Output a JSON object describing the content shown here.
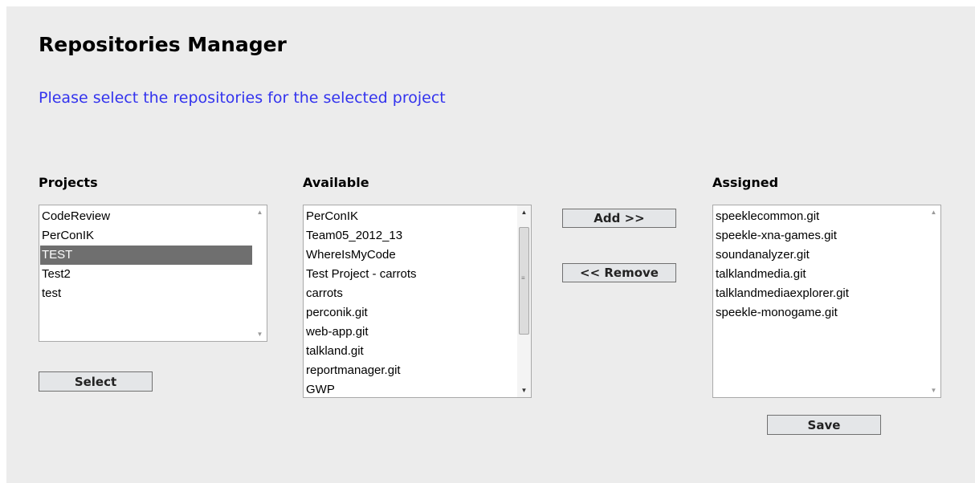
{
  "page": {
    "title": "Repositories Manager",
    "subtitle": "Please select the repositories for the selected project"
  },
  "projects": {
    "label": "Projects",
    "items": [
      "CodeReview",
      "PerConIK",
      "TEST",
      "Test2",
      "test"
    ],
    "selected": "TEST",
    "select_button": "Select"
  },
  "available": {
    "label": "Available",
    "items": [
      "PerConIK",
      "Team05_2012_13",
      "WhereIsMyCode",
      "Test Project - carrots",
      "carrots",
      "perconik.git",
      "web-app.git",
      "talkland.git",
      "reportmanager.git",
      "GWP"
    ]
  },
  "actions": {
    "add_button": "Add >>",
    "remove_button": "<< Remove"
  },
  "assigned": {
    "label": "Assigned",
    "items": [
      "speeklecommon.git",
      "speekle-xna-games.git",
      "soundanalyzer.git",
      "talklandmedia.git",
      "talklandmediaexplorer.git",
      "speekle-monogame.git"
    ],
    "save_button": "Save"
  },
  "icons": {
    "scroll_up": "scroll-up-arrow-icon",
    "scroll_down": "scroll-down-arrow-icon",
    "scroll_grip": "scroll-grip-icon"
  }
}
